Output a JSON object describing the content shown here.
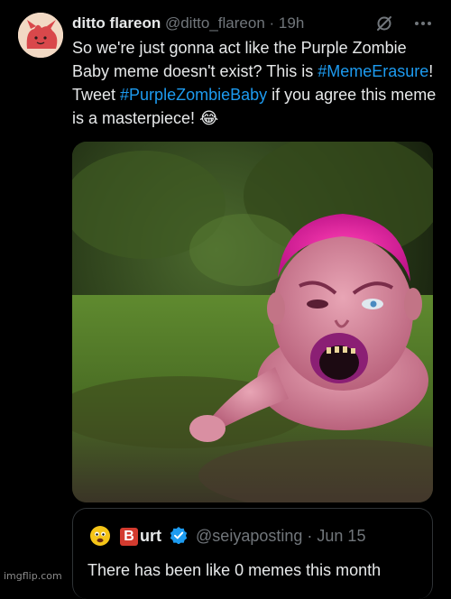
{
  "tweet": {
    "display_name": "ditto flareon",
    "handle": "@ditto_flareon",
    "separator": "·",
    "time": "19h",
    "text_1": "So we're just gonna act like the Purple Zombie Baby meme doesn't exist? This is ",
    "hashtag_1": "#MemeErasure",
    "text_2": "! Tweet ",
    "hashtag_2": "#PurpleZombieBaby",
    "text_3": " if you agree this meme is a masterpiece! ",
    "emoji": "😂",
    "image_description_icon": "grok-slash-icon",
    "more_icon": "more-icon"
  },
  "quote": {
    "badge_letter": "B",
    "display_name": "urt",
    "handle": "@seiyaposting",
    "separator": "·",
    "date": "Jun 15",
    "text": "There has been like 0 memes this month"
  },
  "watermark": "imgflip.com",
  "colors": {
    "background": "#000000",
    "text": "#e7e9ea",
    "muted": "#71767b",
    "link": "#1d9bf0",
    "verified": "#1d9bf0",
    "border": "#2f3336"
  }
}
